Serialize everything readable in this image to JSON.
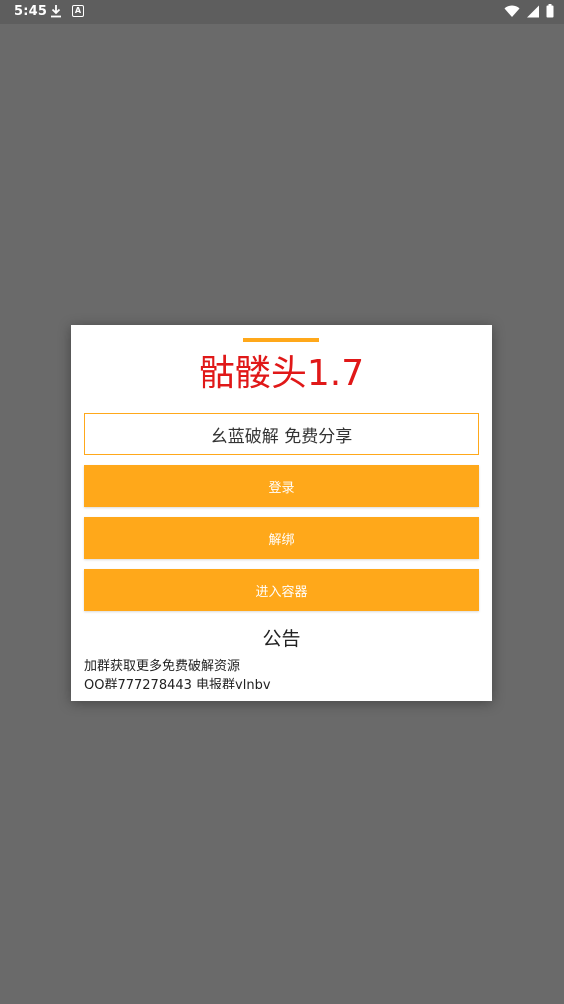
{
  "status_bar": {
    "time": "5:45",
    "icons": [
      "download-icon",
      "app-a-icon",
      "wifi-icon",
      "signal-icon",
      "battery-icon"
    ]
  },
  "dialog": {
    "title": "骷髅头1.7",
    "subtitle": "幺蓝破解 免费分享",
    "buttons": {
      "login": "登录",
      "unbind": "解绑",
      "enter_container": "进入容器"
    },
    "notice": {
      "title": "公告",
      "lines": [
        "加群获取更多免费破解资源",
        "QQ群777278443 电报群ylnbv"
      ]
    }
  },
  "colors": {
    "accent": "#ffa81a",
    "title": "#e01818",
    "backdrop": "#6a6a6a"
  }
}
